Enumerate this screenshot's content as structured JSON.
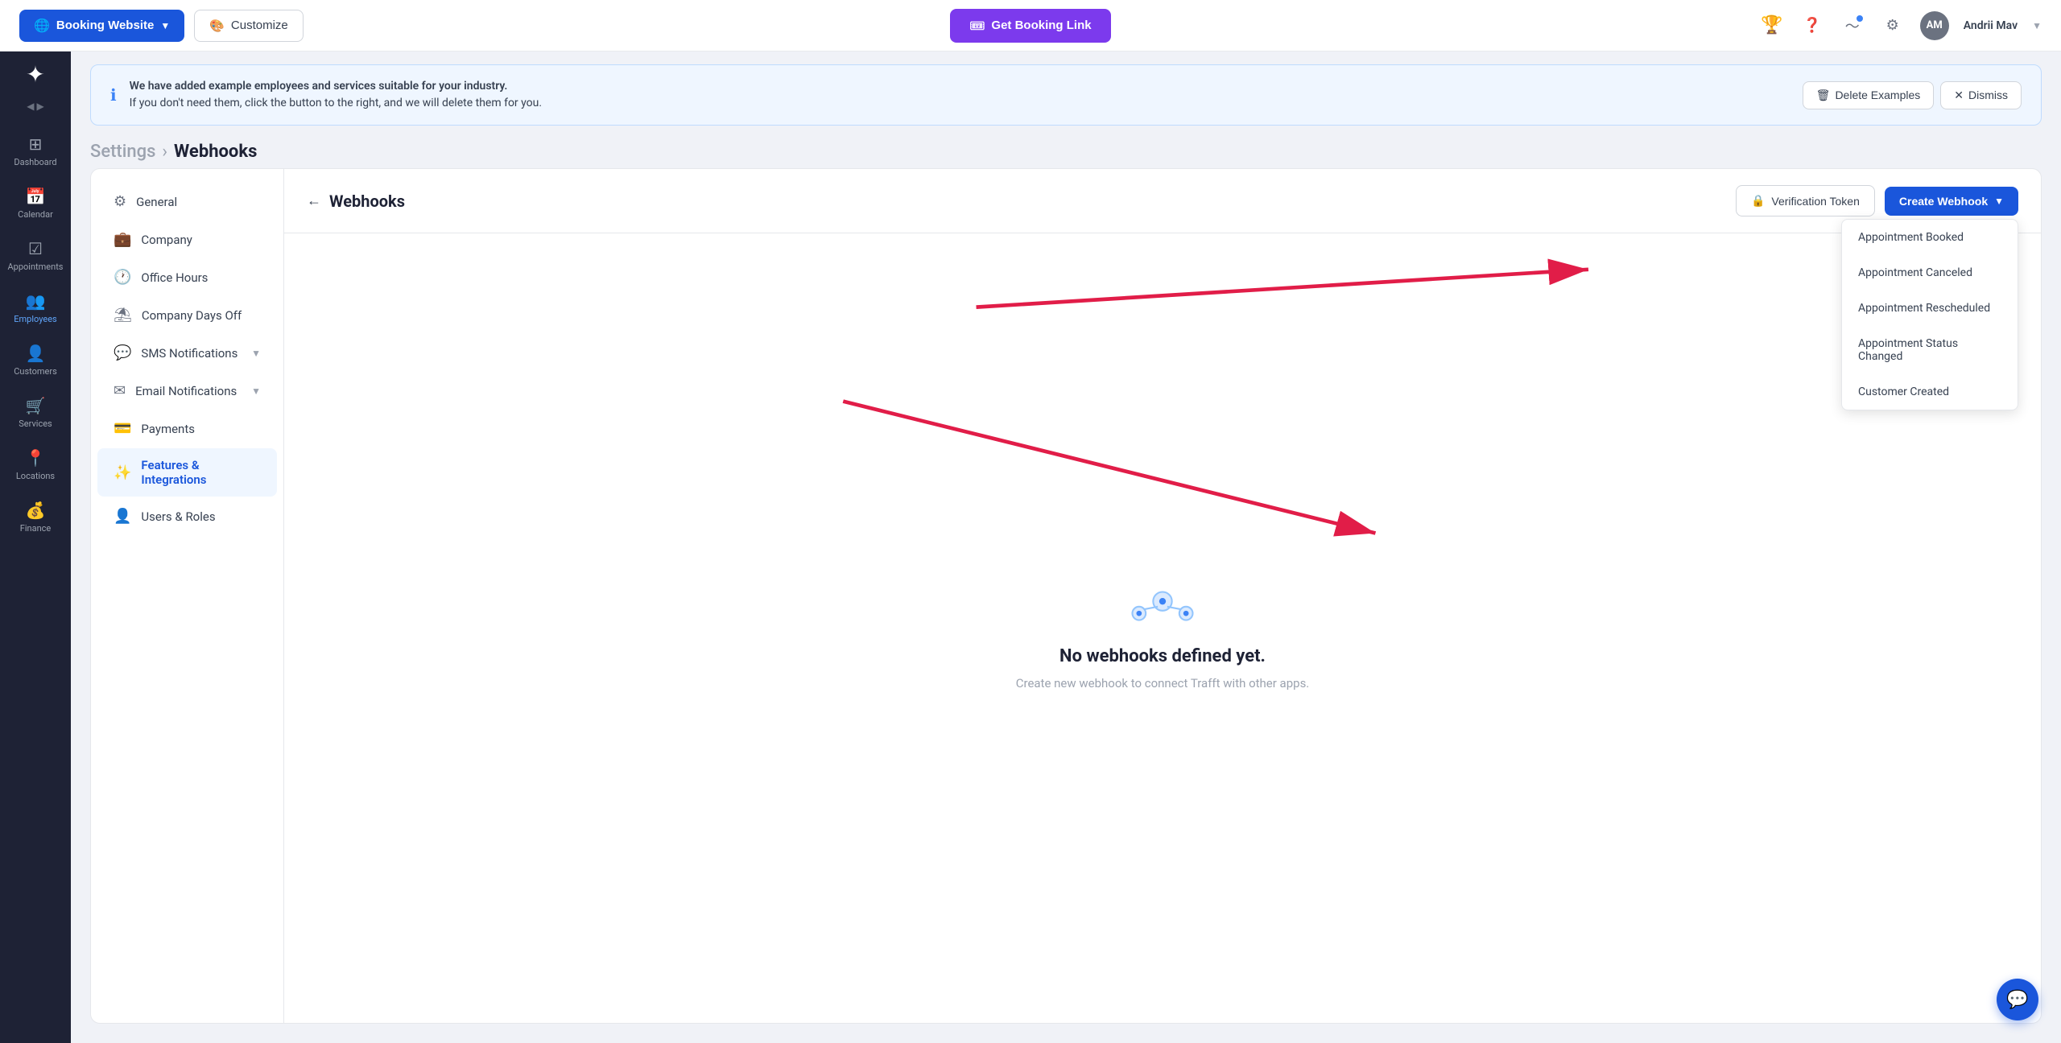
{
  "topnav": {
    "booking_website_label": "Booking Website",
    "customize_label": "Customize",
    "get_booking_link_label": "Get Booking Link",
    "user_initials": "AM",
    "user_name": "Andrii Mav"
  },
  "info_banner": {
    "message_line1": "We have added example employees and services suitable for your industry.",
    "message_line2": "If you don't need them, click the button to the right, and we will delete them for you.",
    "delete_examples_label": "Delete Examples",
    "dismiss_label": "Dismiss"
  },
  "breadcrumb": {
    "settings_label": "Settings",
    "current_label": "Webhooks"
  },
  "settings_nav": {
    "items": [
      {
        "id": "general",
        "label": "General",
        "icon": "⚙"
      },
      {
        "id": "company",
        "label": "Company",
        "icon": "💼"
      },
      {
        "id": "office-hours",
        "label": "Office Hours",
        "icon": "🕐"
      },
      {
        "id": "company-days-off",
        "label": "Company Days Off",
        "icon": "⛱"
      },
      {
        "id": "sms-notifications",
        "label": "SMS Notifications",
        "icon": "💬",
        "has_chevron": true
      },
      {
        "id": "email-notifications",
        "label": "Email Notifications",
        "icon": "✉",
        "has_chevron": true
      },
      {
        "id": "payments",
        "label": "Payments",
        "icon": "💳"
      },
      {
        "id": "features-integrations",
        "label": "Features & Integrations",
        "icon": "✨",
        "active": true
      },
      {
        "id": "users-roles",
        "label": "Users & Roles",
        "icon": "👤"
      }
    ]
  },
  "webhooks": {
    "title": "Webhooks",
    "back_label": "←",
    "verification_token_label": "Verification Token",
    "create_webhook_label": "Create Webhook",
    "empty_title": "No webhooks defined yet.",
    "empty_subtitle": "Create new webhook to connect Trafft with other apps.",
    "dropdown_items": [
      {
        "id": "booked",
        "label": "Appointment Booked"
      },
      {
        "id": "canceled",
        "label": "Appointment Canceled"
      },
      {
        "id": "rescheduled",
        "label": "Appointment Rescheduled"
      },
      {
        "id": "status-changed",
        "label": "Appointment Status Changed"
      },
      {
        "id": "customer-created",
        "label": "Customer Created"
      }
    ]
  },
  "sidebar": {
    "logo": "✦",
    "items": [
      {
        "id": "dashboard",
        "label": "Dashboard",
        "icon": "⊞"
      },
      {
        "id": "calendar",
        "label": "Calendar",
        "icon": "📅"
      },
      {
        "id": "appointments",
        "label": "Appointments",
        "icon": "✓"
      },
      {
        "id": "employees",
        "label": "Employees",
        "icon": "👥",
        "active": true
      },
      {
        "id": "customers",
        "label": "Customers",
        "icon": "👤"
      },
      {
        "id": "services",
        "label": "Services",
        "icon": "🛒"
      },
      {
        "id": "locations",
        "label": "Locations",
        "icon": "📍"
      },
      {
        "id": "finance",
        "label": "Finance",
        "icon": "💰"
      }
    ]
  },
  "chat_button": {
    "icon": "💬"
  }
}
